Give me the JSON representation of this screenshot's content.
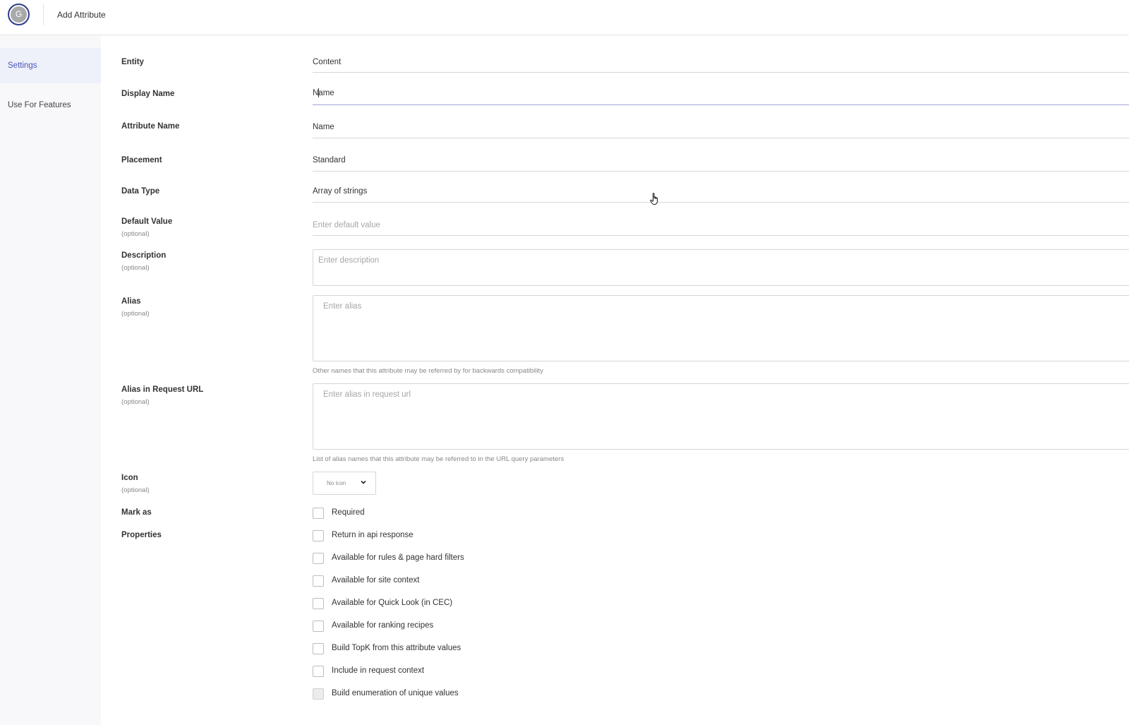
{
  "header": {
    "avatar_initial": "G",
    "title": "Add Attribute"
  },
  "sidebar": {
    "items": [
      {
        "label": "Settings",
        "active": true
      },
      {
        "label": "Use For Features",
        "active": false
      }
    ]
  },
  "form": {
    "entity": {
      "label": "Entity",
      "value": "Content"
    },
    "display_name": {
      "label": "Display Name",
      "value": "Name"
    },
    "attribute_name": {
      "label": "Attribute Name",
      "value": "Name"
    },
    "placement": {
      "label": "Placement",
      "value": "Standard"
    },
    "data_type": {
      "label": "Data Type",
      "value": "Array of strings"
    },
    "default_value": {
      "label": "Default Value",
      "sublabel": "(optional)",
      "placeholder": "Enter default value"
    },
    "description": {
      "label": "Description",
      "sublabel": "(optional)",
      "placeholder": "Enter description"
    },
    "alias": {
      "label": "Alias",
      "sublabel": "(optional)",
      "placeholder": "Enter alias",
      "hint": "Other names that this attribute may be referred by for backwards compatibility"
    },
    "alias_request_url": {
      "label": "Alias in Request URL",
      "sublabel": "(optional)",
      "placeholder": "Enter alias in request url",
      "hint": "List of alias names that this attribute may be referred to in the URL query parameters"
    },
    "icon": {
      "label": "Icon",
      "sublabel": "(optional)",
      "value": "No icon"
    },
    "mark_as": {
      "label": "Mark as",
      "options": [
        {
          "label": "Required",
          "checked": false
        }
      ]
    },
    "properties": {
      "label": "Properties",
      "options": [
        {
          "label": "Return in api response",
          "checked": false,
          "disabled": false
        },
        {
          "label": "Available for rules & page hard filters",
          "checked": false,
          "disabled": false
        },
        {
          "label": "Available for site context",
          "checked": false,
          "disabled": false
        },
        {
          "label": "Available for Quick Look (in CEC)",
          "checked": false,
          "disabled": false
        },
        {
          "label": "Available for ranking recipes",
          "checked": false,
          "disabled": false
        },
        {
          "label": "Build TopK from this attribute values",
          "checked": false,
          "disabled": false
        },
        {
          "label": "Include in request context",
          "checked": false,
          "disabled": false
        },
        {
          "label": "Build enumeration of unique values",
          "checked": false,
          "disabled": true
        }
      ]
    }
  },
  "colors": {
    "accent": "#4a55b8",
    "sidebar_bg": "#f8f8fa",
    "active_bg": "#eef0fa"
  }
}
